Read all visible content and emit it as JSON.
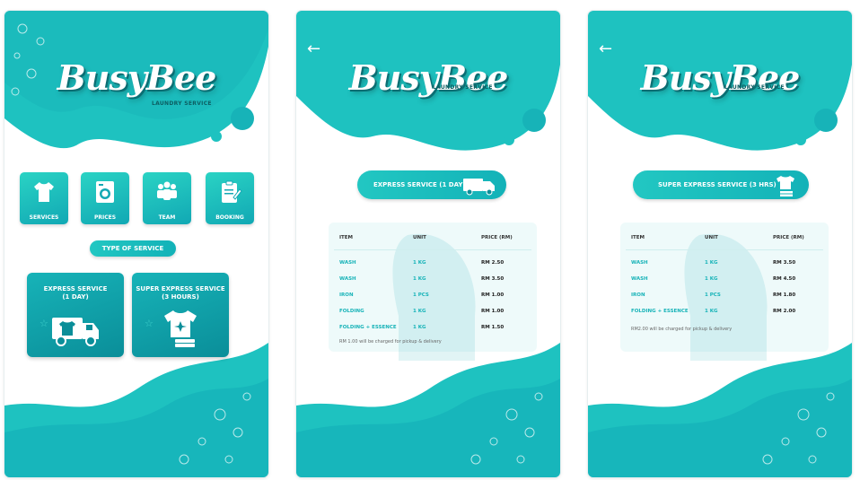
{
  "brand": {
    "name": "BusyBee",
    "tagline": "LAUNDRY SERVICE"
  },
  "colors": {
    "primary": "#1ec2c0",
    "dark": "#0a8e99",
    "text": "#222222"
  },
  "home": {
    "menu": [
      {
        "label": "SERVICES",
        "icon": "tshirt-icon"
      },
      {
        "label": "PRICES",
        "icon": "washing-machine-icon"
      },
      {
        "label": "TEAM",
        "icon": "team-icon"
      },
      {
        "label": "BOOKING",
        "icon": "clipboard-icon"
      }
    ],
    "section_title": "TYPE OF SERVICE",
    "cards": [
      {
        "title_line1": "EXPRESS SERVICE",
        "title_line2": "(1 DAY)",
        "icon": "delivery-truck-icon"
      },
      {
        "title_line1": "SUPER EXPRESS SERVICE",
        "title_line2": "(3 HOURS)",
        "icon": "clean-shirt-icon"
      }
    ]
  },
  "express": {
    "back_icon": "arrow-left-icon",
    "title": "EXPRESS SERVICE (1 DAY)",
    "columns": [
      "ITEM",
      "UNIT",
      "PRICE (RM)"
    ],
    "rows": [
      {
        "item": "WASH",
        "unit": "1 KG",
        "price": "RM 2.50"
      },
      {
        "item": "WASH",
        "unit": "1 KG",
        "price": "RM 3.50"
      },
      {
        "item": "IRON",
        "unit": "1 PCS",
        "price": "RM 1.00"
      },
      {
        "item": "FOLDING",
        "unit": "1 KG",
        "price": "RM 1.00"
      },
      {
        "item": "FOLDING + ESSENCE",
        "unit": "1 KG",
        "price": "RM 1.50"
      }
    ],
    "note": "RM 1.00 will be charged for pickup & delivery"
  },
  "super_express": {
    "back_icon": "arrow-left-icon",
    "title": "SUPER EXPRESS SERVICE (3 HRS)",
    "columns": [
      "ITEM",
      "UNIT",
      "PRICE (RM)"
    ],
    "rows": [
      {
        "item": "WASH",
        "unit": "1 KG",
        "price": "RM 3.50"
      },
      {
        "item": "WASH",
        "unit": "1 KG",
        "price": "RM 4.50"
      },
      {
        "item": "IRON",
        "unit": "1 PCS",
        "price": "RM 1.80"
      },
      {
        "item": "FOLDING + ESSENCE",
        "unit": "1 KG",
        "price": "RM 2.00"
      }
    ],
    "note": "RM2.00 will be charged for pickup & delivery"
  }
}
